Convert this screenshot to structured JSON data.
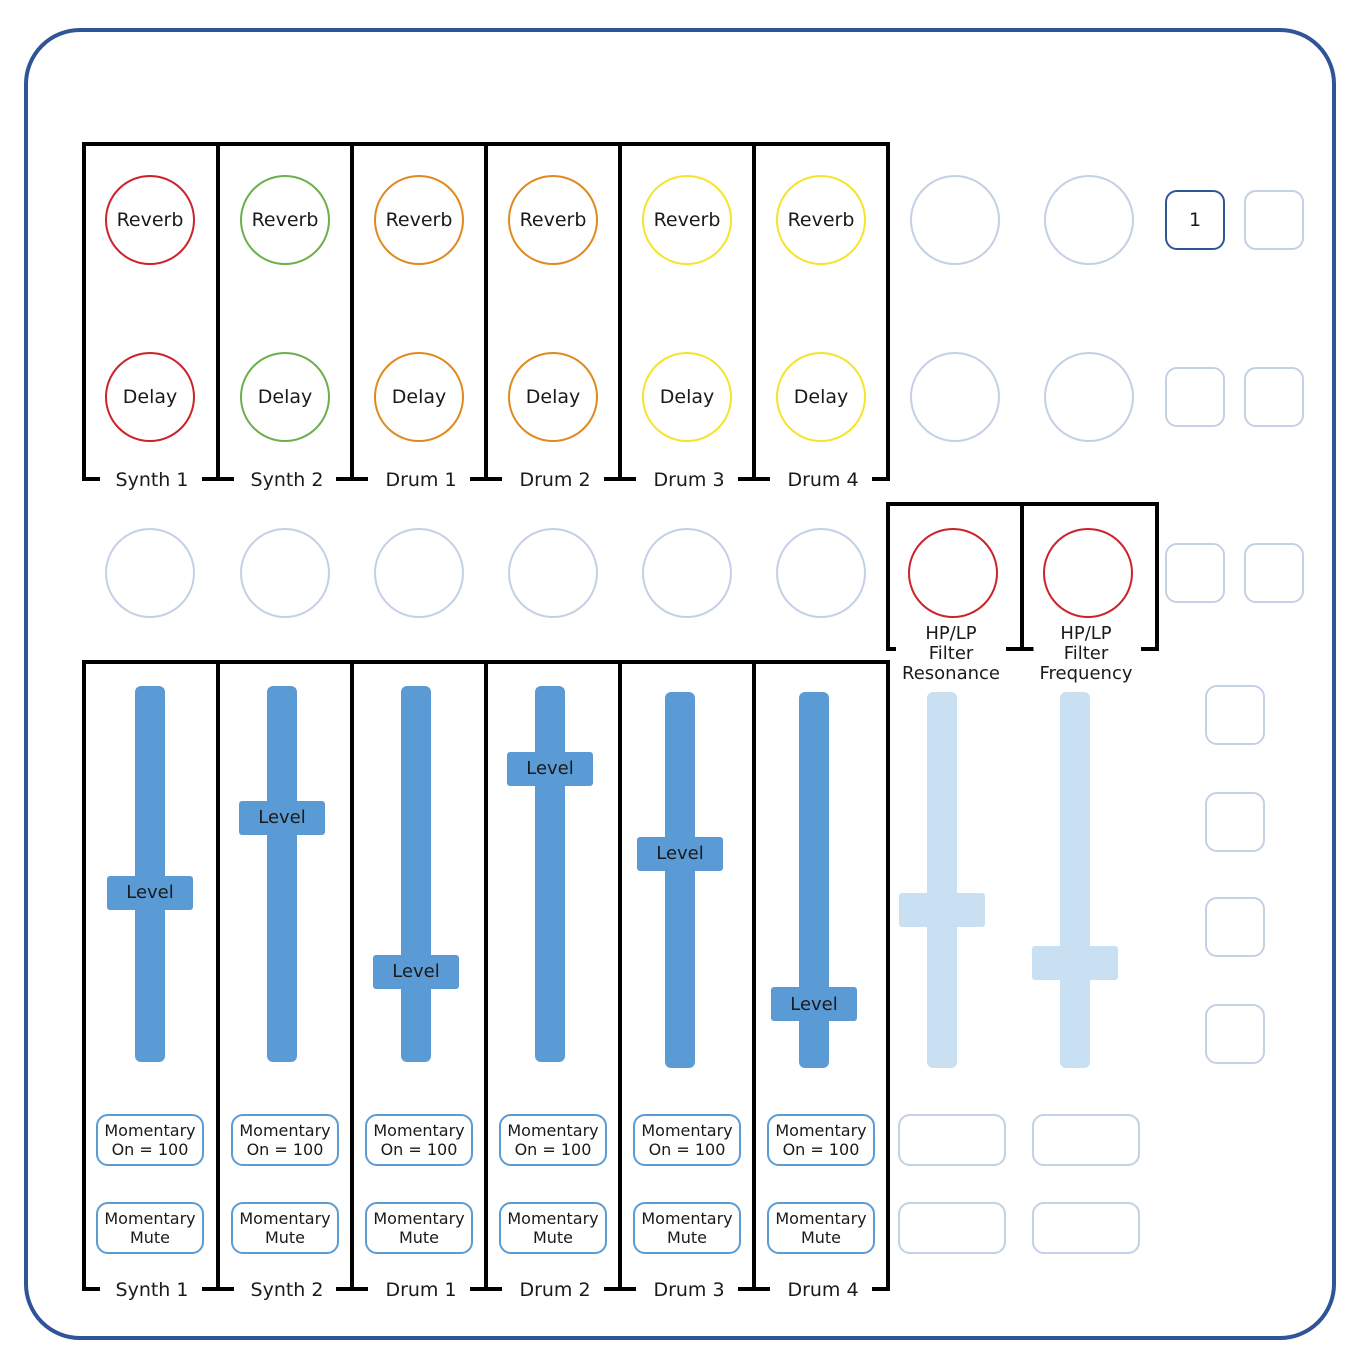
{
  "colors": {
    "frame": "#2f5597",
    "inactive": "#c3d0e6",
    "slider": "#5b9bd5",
    "slider_inactive": "#c9dff2",
    "red": "#cc2229",
    "green": "#6ab04c",
    "orange": "#e08a1e",
    "yellow": "#f5e42a"
  },
  "channels": [
    {
      "name": "Synth 1",
      "color": "red",
      "reverb": "Reverb",
      "delay": "Delay",
      "level_label": "Level",
      "level": 0.45,
      "momentary_on": "Momentary\nOn = 100",
      "momentary_mute": "Momentary\nMute"
    },
    {
      "name": "Synth 2",
      "color": "green",
      "reverb": "Reverb",
      "delay": "Delay",
      "level_label": "Level",
      "level": 0.65,
      "momentary_on": "Momentary\nOn = 100",
      "momentary_mute": "Momentary\nMute"
    },
    {
      "name": "Drum 1",
      "color": "orange",
      "reverb": "Reverb",
      "delay": "Delay",
      "level_label": "Level",
      "level": 0.24,
      "momentary_on": "Momentary\nOn = 100",
      "momentary_mute": "Momentary\nMute"
    },
    {
      "name": "Drum 2",
      "color": "orange",
      "reverb": "Reverb",
      "delay": "Delay",
      "level_label": "Level",
      "level": 0.78,
      "momentary_on": "Momentary\nOn = 100",
      "momentary_mute": "Momentary\nMute"
    },
    {
      "name": "Drum 3",
      "color": "yellow",
      "reverb": "Reverb",
      "delay": "Delay",
      "level_label": "Level",
      "level": 0.57,
      "momentary_on": "Momentary\nOn = 100",
      "momentary_mute": "Momentary\nMute"
    },
    {
      "name": "Drum 4",
      "color": "yellow",
      "reverb": "Reverb",
      "delay": "Delay",
      "level_label": "Level",
      "level": 0.17,
      "momentary_on": "Momentary\nOn = 100",
      "momentary_mute": "Momentary\nMute"
    }
  ],
  "filter": [
    {
      "label": "HP/LP\nFilter\nResonance",
      "color": "red",
      "fader": 0.42
    },
    {
      "label": "HP/LP\nFilter\nFrequency",
      "color": "red",
      "fader": 0.28
    }
  ],
  "pads": {
    "active_label": "1"
  }
}
